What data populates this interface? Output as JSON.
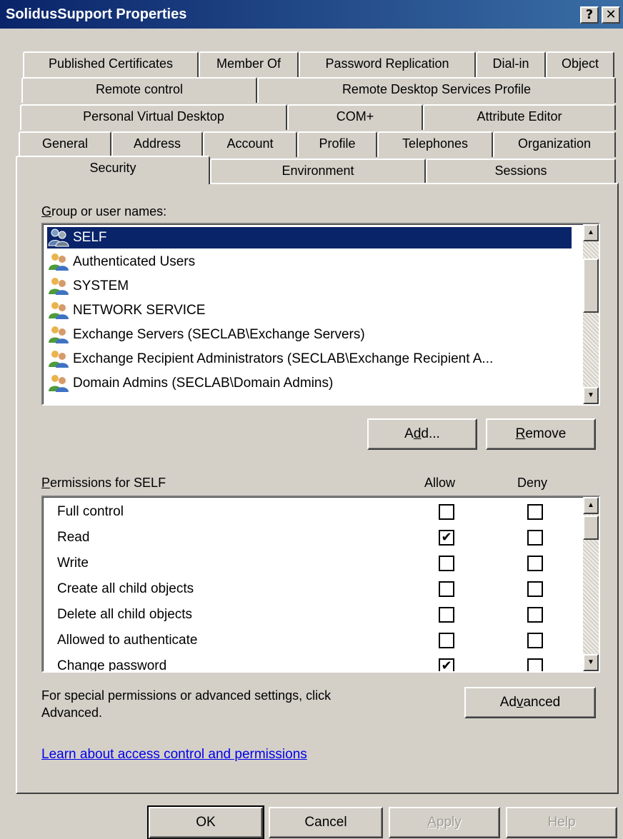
{
  "window": {
    "title": "SolidusSupport Properties",
    "help_glyph": "?",
    "close_glyph": "✕"
  },
  "tabs": {
    "row1": [
      "Published Certificates",
      "Member Of",
      "Password Replication",
      "Dial-in",
      "Object"
    ],
    "row2": [
      "Remote control",
      "Remote Desktop Services Profile"
    ],
    "row3": [
      "Personal Virtual Desktop",
      "COM+",
      "Attribute Editor"
    ],
    "row4": [
      "General",
      "Address",
      "Account",
      "Profile",
      "Telephones",
      "Organization"
    ],
    "row5": [
      "Security",
      "Environment",
      "Sessions"
    ],
    "active": "Security"
  },
  "groups": {
    "label_mnemonic": "G",
    "label_rest": "roup or user names:",
    "items": [
      "SELF",
      "Authenticated Users",
      "SYSTEM",
      "NETWORK SERVICE",
      "Exchange Servers (SECLAB\\Exchange Servers)",
      "Exchange Recipient Administrators (SECLAB\\Exchange Recipient A...",
      "Domain Admins (SECLAB\\Domain Admins)"
    ],
    "selected": "SELF",
    "add_pre": "A",
    "add_mnemonic": "d",
    "add_post": "d...",
    "remove_mnemonic": "R",
    "remove_post": "emove"
  },
  "permissions": {
    "label_mnemonic": "P",
    "label_rest": "ermissions for SELF",
    "allow_header": "Allow",
    "deny_header": "Deny",
    "rows": [
      {
        "name": "Full control",
        "allow": false,
        "deny": false
      },
      {
        "name": "Read",
        "allow": true,
        "deny": false
      },
      {
        "name": "Write",
        "allow": false,
        "deny": false
      },
      {
        "name": "Create all child objects",
        "allow": false,
        "deny": false
      },
      {
        "name": "Delete all child objects",
        "allow": false,
        "deny": false
      },
      {
        "name": "Allowed to authenticate",
        "allow": false,
        "deny": false
      },
      {
        "name": "Change password",
        "allow": true,
        "deny": false
      }
    ]
  },
  "advanced": {
    "text_line1": "For special permissions or advanced settings, click",
    "text_line2": "Advanced.",
    "button_pre": "Ad",
    "button_mnemonic": "v",
    "button_post": "anced"
  },
  "learn_link": "Learn about access control and permissions",
  "footer": {
    "ok": "OK",
    "cancel": "Cancel",
    "apply_mnemonic": "A",
    "apply_post": "pply",
    "help": "Help"
  },
  "icons": {
    "check": "✔",
    "scroll_up": "▲",
    "scroll_down": "▼"
  },
  "colors": {
    "titlebar": "#0a246a",
    "selection": "#0a246a",
    "link": "#0000ee",
    "face": "#d4d0c8"
  }
}
